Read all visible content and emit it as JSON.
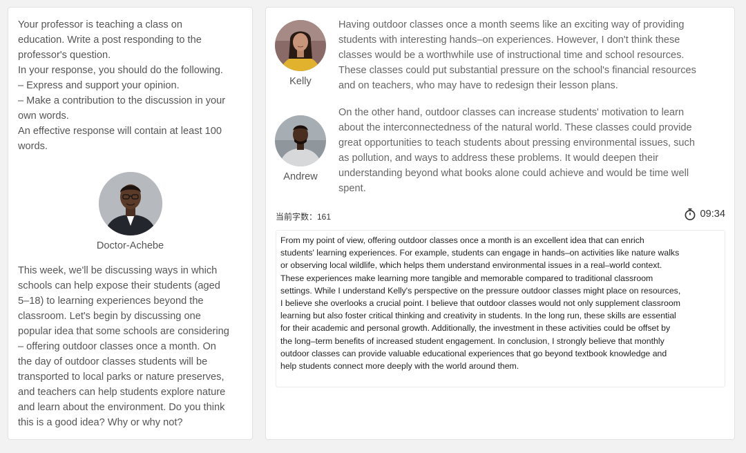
{
  "instructions": {
    "lines": [
      "Your professor is teaching a class on",
      "education. Write a post responding to the",
      "professor's question.",
      "In your response, you should do the following.",
      "– Express and support your opinion.",
      "– Make a contribution to the discussion in your",
      "own words.",
      "An effective response will contain at least 100",
      "words."
    ]
  },
  "professor": {
    "name": "Doctor-Achebe",
    "question_lines": [
      "This week, we'll be discussing ways in which",
      "schools can help expose their students (aged",
      "5–18) to learning experiences beyond the",
      "classroom. Let's begin by discussing one",
      "popular idea that some schools are considering",
      "– offering outdoor classes once a month. On",
      "the day of outdoor classes students will be",
      "transported to local parks or nature preserves,",
      "and teachers can help students explore nature",
      "and learn about the environment. Do you think",
      "this is a good idea? Why or why not?"
    ]
  },
  "students": [
    {
      "name": "Kelly",
      "lines": [
        "Having outdoor classes once a month seems like an exciting way of providing",
        "students with interesting hands–on experiences. However, I don't think these",
        "classes would be a worthwhile use of instructional time and school resources.",
        "These classes could put substantial pressure on the school's financial resources",
        "and on teachers, who may have to redesign their lesson plans."
      ]
    },
    {
      "name": "Andrew",
      "lines": [
        "On the other hand, outdoor classes can increase students' motivation to learn",
        "about the interconnectedness of the natural world. These classes could provide",
        "great opportunities to teach students about pressing environmental issues, such",
        "as pollution, and ways to address these problems. It would deepen their",
        "understanding beyond what books alone could achieve and would be time well",
        "spent."
      ]
    }
  ],
  "editor": {
    "word_count_label": "当前字数：161",
    "timer": "09:34",
    "timer_icon": "stopwatch-icon",
    "response_lines": [
      "From my point of view, offering outdoor classes once a month is an excellent idea that can enrich",
      "students' learning experiences. For example, students can engage in hands–on activities like nature walks",
      "or observing local wildlife, which helps them understand environmental issues in a real–world context.",
      "These experiences make learning more tangible and memorable compared to traditional classroom",
      "settings. While I understand Kelly's perspective on the pressure outdoor classes might place on resources,",
      "I believe she overlooks a crucial point. I believe that outdoor classes would not only supplement classroom",
      "learning but also foster critical thinking and creativity in students. In the long run, these skills are essential",
      "for their academic and personal growth. Additionally, the investment in these activities could be offset by",
      "the long–term benefits of increased student engagement. In conclusion, I strongly believe that monthly",
      "outdoor classes can provide valuable educational experiences that go beyond textbook knowledge and",
      "help students connect more deeply with the world around them."
    ]
  }
}
